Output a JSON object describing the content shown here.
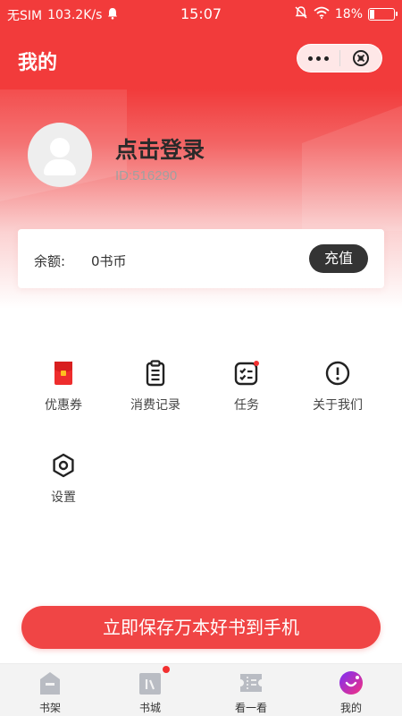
{
  "status_bar": {
    "carrier": "无SIM",
    "speed": "103.2K/s",
    "time": "15:07",
    "battery": "18%",
    "battery_level": 0.18
  },
  "header": {
    "title": "我的",
    "more_icon": "more-dots-icon",
    "close_icon": "close-circle-icon"
  },
  "profile": {
    "login_text": "点击登录",
    "user_id": "ID:516290"
  },
  "balance": {
    "label": "余额:",
    "value": "0书币",
    "recharge_label": "充值"
  },
  "menu": [
    {
      "label": "优惠券",
      "icon": "coupon-icon"
    },
    {
      "label": "消费记录",
      "icon": "clipboard-icon"
    },
    {
      "label": "任务",
      "icon": "task-list-icon"
    },
    {
      "label": "关于我们",
      "icon": "info-circle-icon"
    },
    {
      "label": "设置",
      "icon": "settings-hexagon-icon"
    }
  ],
  "cta": {
    "label": "立即保存万本好书到手机"
  },
  "tabs": [
    {
      "label": "书架",
      "icon": "bookshelf-icon",
      "active": false
    },
    {
      "label": "书城",
      "icon": "bookstore-icon",
      "active": false,
      "badge_dot": true
    },
    {
      "label": "看一看",
      "icon": "ticket-icon",
      "active": false
    },
    {
      "label": "我的",
      "icon": "profile-icon",
      "active": true
    }
  ],
  "colors": {
    "brand_red": "#f23b3b",
    "cta_red": "#f04545",
    "recharge_dark": "#343434",
    "tab_active_purple": "#7b2ff7",
    "tab_active_pink": "#f5317f"
  }
}
